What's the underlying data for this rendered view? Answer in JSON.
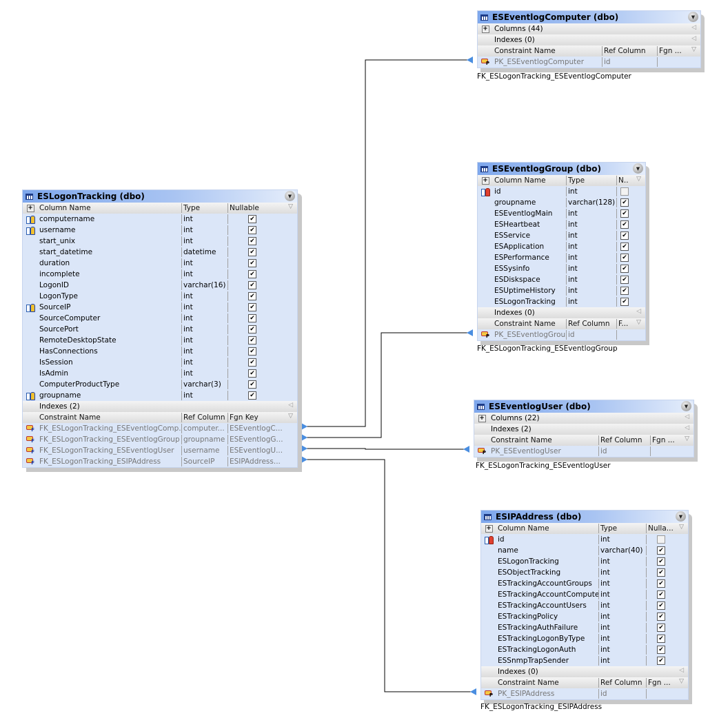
{
  "tables": {
    "logon": {
      "title": "ESLogonTracking (dbo)",
      "headers": {
        "name": "Column Name",
        "type": "Type",
        "nullable": "Nullable"
      },
      "columns": [
        {
          "name": "computername",
          "type": "int",
          "nullable": true,
          "fk": true
        },
        {
          "name": "username",
          "type": "int",
          "nullable": true,
          "fk": true
        },
        {
          "name": "start_unix",
          "type": "int",
          "nullable": true
        },
        {
          "name": "start_datetime",
          "type": "datetime",
          "nullable": true
        },
        {
          "name": "duration",
          "type": "int",
          "nullable": true
        },
        {
          "name": "incomplete",
          "type": "int",
          "nullable": true
        },
        {
          "name": "LogonID",
          "type": "varchar(16)",
          "nullable": true
        },
        {
          "name": "LogonType",
          "type": "int",
          "nullable": true
        },
        {
          "name": "SourceIP",
          "type": "int",
          "nullable": true,
          "fk": true
        },
        {
          "name": "SourceComputer",
          "type": "int",
          "nullable": true
        },
        {
          "name": "SourcePort",
          "type": "int",
          "nullable": true
        },
        {
          "name": "RemoteDesktopState",
          "type": "int",
          "nullable": true
        },
        {
          "name": "HasConnections",
          "type": "int",
          "nullable": true
        },
        {
          "name": "IsSession",
          "type": "int",
          "nullable": true
        },
        {
          "name": "IsAdmin",
          "type": "int",
          "nullable": true
        },
        {
          "name": "ComputerProductType",
          "type": "varchar(3)",
          "nullable": true
        },
        {
          "name": "groupname",
          "type": "int",
          "nullable": true,
          "fk": true
        }
      ],
      "indexes": "Indexes (2)",
      "constraint_headers": {
        "name": "Constraint Name",
        "ref": "Ref Column",
        "fgn": "Fgn Key"
      },
      "constraints": [
        {
          "name": "FK_ESLogonTracking_ESEventlogComp...",
          "ref": "computer...",
          "fgn": "ESEventlogC..."
        },
        {
          "name": "FK_ESLogonTracking_ESEventlogGroup",
          "ref": "groupname",
          "fgn": "ESEventlogG..."
        },
        {
          "name": "FK_ESLogonTracking_ESEventlogUser",
          "ref": "username",
          "fgn": "ESEventlogU..."
        },
        {
          "name": "FK_ESLogonTracking_ESIPAddress",
          "ref": "SourceIP",
          "fgn": "ESIPAddress..."
        }
      ]
    },
    "computer": {
      "title": "ESEventlogComputer (dbo)",
      "columns_label": "Columns (44)",
      "indexes": "Indexes (0)",
      "constraint_headers": {
        "name": "Constraint Name",
        "ref": "Ref Column",
        "fgn": "Fgn ..."
      },
      "constraints": [
        {
          "name": "PK_ESEventlogComputer",
          "ref": "id",
          "fgn": ""
        }
      ],
      "caption": "FK_ESLogonTracking_ESEventlogComputer"
    },
    "group": {
      "title": "ESEventlogGroup (dbo)",
      "headers": {
        "name": "Column Name",
        "type": "Type",
        "nullable": "N.."
      },
      "columns": [
        {
          "name": "id",
          "type": "int",
          "nullable": false,
          "pk": true
        },
        {
          "name": "groupname",
          "type": "varchar(128)",
          "nullable": true
        },
        {
          "name": "ESEventlogMain",
          "type": "int",
          "nullable": true
        },
        {
          "name": "ESHeartbeat",
          "type": "int",
          "nullable": true
        },
        {
          "name": "ESService",
          "type": "int",
          "nullable": true
        },
        {
          "name": "ESApplication",
          "type": "int",
          "nullable": true
        },
        {
          "name": "ESPerformance",
          "type": "int",
          "nullable": true
        },
        {
          "name": "ESSysinfo",
          "type": "int",
          "nullable": true
        },
        {
          "name": "ESDiskspace",
          "type": "int",
          "nullable": true
        },
        {
          "name": "ESUptimeHistory",
          "type": "int",
          "nullable": true
        },
        {
          "name": "ESLogonTracking",
          "type": "int",
          "nullable": true
        }
      ],
      "indexes": "Indexes (0)",
      "constraint_headers": {
        "name": "Constraint Name",
        "ref": "Ref Column",
        "fgn": "F..."
      },
      "constraints": [
        {
          "name": "PK_ESEventlogGroup",
          "ref": "id",
          "fgn": ""
        }
      ],
      "caption": "FK_ESLogonTracking_ESEventlogGroup"
    },
    "user": {
      "title": "ESEventlogUser (dbo)",
      "columns_label": "Columns (22)",
      "indexes": "Indexes (2)",
      "constraint_headers": {
        "name": "Constraint Name",
        "ref": "Ref Column",
        "fgn": "Fgn ..."
      },
      "constraints": [
        {
          "name": "PK_ESEventlogUser",
          "ref": "id",
          "fgn": ""
        }
      ],
      "caption": "FK_ESLogonTracking_ESEventlogUser"
    },
    "ip": {
      "title": "ESIPAddress (dbo)",
      "headers": {
        "name": "Column Name",
        "type": "Type",
        "nullable": "Nulla..."
      },
      "columns": [
        {
          "name": "id",
          "type": "int",
          "nullable": false,
          "pk": true
        },
        {
          "name": "name",
          "type": "varchar(40)",
          "nullable": true
        },
        {
          "name": "ESLogonTracking",
          "type": "int",
          "nullable": true
        },
        {
          "name": "ESObjectTracking",
          "type": "int",
          "nullable": true
        },
        {
          "name": "ESTrackingAccountGroups",
          "type": "int",
          "nullable": true
        },
        {
          "name": "ESTrackingAccountComputers",
          "type": "int",
          "nullable": true
        },
        {
          "name": "ESTrackingAccountUsers",
          "type": "int",
          "nullable": true
        },
        {
          "name": "ESTrackingPolicy",
          "type": "int",
          "nullable": true
        },
        {
          "name": "ESTrackingAuthFailure",
          "type": "int",
          "nullable": true
        },
        {
          "name": "ESTrackingLogonByType",
          "type": "int",
          "nullable": true
        },
        {
          "name": "ESTrackingLogonAuth",
          "type": "int",
          "nullable": true
        },
        {
          "name": "ESSnmpTrapSender",
          "type": "int",
          "nullable": true
        }
      ],
      "indexes": "Indexes (0)",
      "constraint_headers": {
        "name": "Constraint Name",
        "ref": "Ref Column",
        "fgn": "Fgn ..."
      },
      "constraints": [
        {
          "name": "PK_ESIPAddress",
          "ref": "id",
          "fgn": ""
        }
      ],
      "caption": "FK_ESLogonTracking_ESIPAddress"
    }
  },
  "colors": {
    "title_start": "#7ea7ec",
    "row_bg": "#dbe6f8",
    "connector": "#000000",
    "arrow": "#4a8ee0"
  }
}
